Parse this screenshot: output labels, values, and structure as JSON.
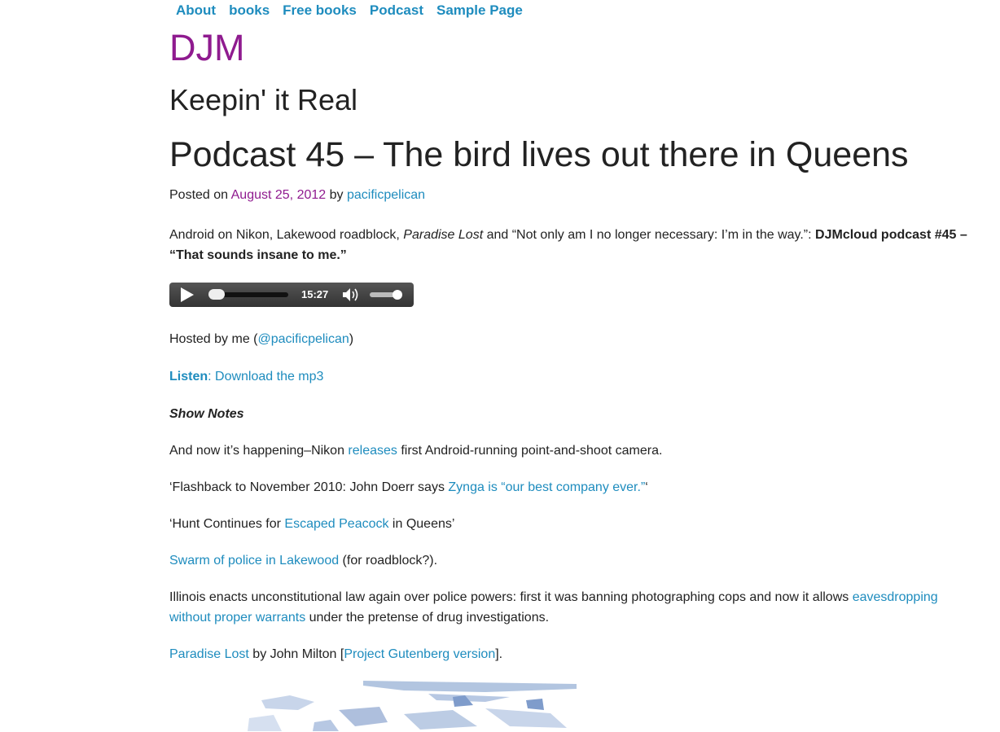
{
  "nav": {
    "items": [
      {
        "label": "About"
      },
      {
        "label": "books"
      },
      {
        "label": "Free books"
      },
      {
        "label": "Podcast"
      },
      {
        "label": "Sample Page"
      }
    ]
  },
  "site": {
    "title": "DJM",
    "tagline": "Keepin' it Real"
  },
  "post": {
    "title": "Podcast 45 – The bird lives out there in Queens",
    "meta": {
      "posted_on": "Posted on",
      "date": "August 25, 2012",
      "by": "by",
      "author": "pacificpelican"
    },
    "intro": {
      "t1": "Android on Nikon, Lakewood roadblock, ",
      "em": "Paradise Lost",
      "t2": " and “Not only am I no longer necessary: I’m in the way.”: ",
      "strong": "DJMcloud podcast #45 – “That sounds insane to me.”"
    },
    "player": {
      "time": "15:27",
      "progress": 0.0,
      "volume": 0.8,
      "play_icon": "play-icon",
      "speaker_icon": "speaker-icon"
    },
    "hosted": {
      "t1": "Hosted by me (",
      "link": "@pacificpelican",
      "t2": ")"
    },
    "listen": {
      "label": "Listen",
      "sep": ": ",
      "link": "Download the mp3"
    },
    "show_notes": "Show Notes",
    "notes": {
      "n1": {
        "t1": "And now it’s happening–Nikon ",
        "link": "releases",
        "t2": " first Android-running point-and-shoot camera."
      },
      "n2": {
        "t1": "‘Flashback to November 2010: John Doerr says ",
        "link": "Zynga is “our best company ever.”",
        "t2": "‘"
      },
      "n3": {
        "t1": "‘Hunt Continues for ",
        "link": "Escaped Peacock",
        "t2": " in Queens’"
      },
      "n4": {
        "link": "Swarm of police in Lakewood",
        "t2": " (for roadblock?)."
      },
      "n5": {
        "t1": "Illinois enacts unconstitutional law again over police powers: first it was banning photographing cops and now it allows ",
        "link": "eavesdropping without proper warrants",
        "t2": " under the pretense of drug investigations."
      },
      "n6": {
        "link": "Paradise Lost",
        "t2": " by John Milton [",
        "link2": "Project Gutenberg version",
        "t3": "]."
      }
    }
  }
}
